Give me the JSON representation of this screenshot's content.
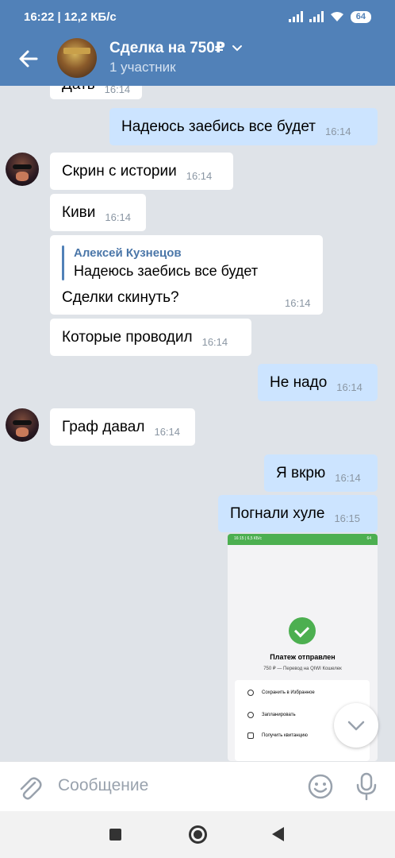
{
  "status_bar": {
    "time_speed": "16:22 | 12,2 КБ/с",
    "battery": "64"
  },
  "header": {
    "title": "Сделка на 750₽",
    "subtitle": "1 участник"
  },
  "messages": {
    "m0": {
      "text": "Дать",
      "time": "16:14"
    },
    "m1": {
      "text": "Надеюсь заебись все будет",
      "time": "16:14"
    },
    "m2": {
      "text": "Скрин с истории",
      "time": "16:14"
    },
    "m3": {
      "text": "Киви",
      "time": "16:14"
    },
    "m4": {
      "reply_name": "Алексей Кузнецов",
      "reply_text": "Надеюсь заебись все будет",
      "text": "Сделки скинуть?",
      "time": "16:14"
    },
    "m5": {
      "text": "Которые проводил",
      "time": "16:14"
    },
    "m6": {
      "text": "Не надо",
      "time": "16:14"
    },
    "m7": {
      "text": "Граф давал",
      "time": "16:14"
    },
    "m8": {
      "text": "Я вкрю",
      "time": "16:14"
    },
    "m9": {
      "text": "Погнали хуле",
      "time": "16:15"
    }
  },
  "attachment": {
    "status_left": "16:15 | 6,5 КБ/с",
    "status_right": "64",
    "title": "Платеж отправлен",
    "subtitle": "750 ₽ — Перевод на QIWI Кошелек",
    "actions": [
      "Сохранить в Избранное",
      "Запланировать",
      "Получить квитанцию"
    ]
  },
  "compose": {
    "placeholder": "Сообщение"
  },
  "colors": {
    "header": "#5181b8",
    "outgoing_bubble": "#cce4ff",
    "incoming_bubble": "#ffffff",
    "background": "#dfe3e8"
  }
}
